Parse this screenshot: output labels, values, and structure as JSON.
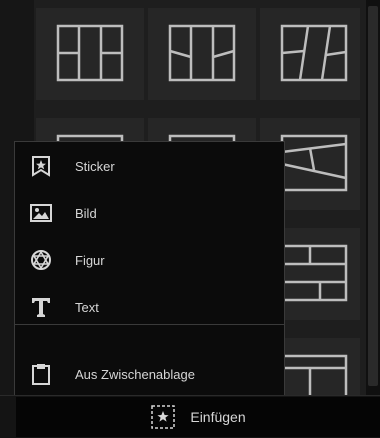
{
  "context_menu": {
    "items": [
      {
        "label": "Sticker",
        "icon": "sticker-icon"
      },
      {
        "label": "Bild",
        "icon": "image-icon"
      },
      {
        "label": "Figur",
        "icon": "shape-icon"
      },
      {
        "label": "Text",
        "icon": "text-icon"
      }
    ],
    "clipboard_item": {
      "label": "Aus Zwischenablage",
      "icon": "clipboard-icon"
    }
  },
  "bottom_bar": {
    "insert_label": "Einfügen",
    "insert_icon": "sticker-icon"
  },
  "layout_tiles": [
    "collage-layout-icon",
    "collage-layout-icon",
    "collage-layout-icon",
    "collage-layout-icon",
    "collage-layout-icon",
    "collage-layout-icon",
    "collage-layout-icon",
    "collage-layout-icon",
    "collage-layout-icon",
    "collage-layout-icon",
    "collage-layout-icon",
    "collage-layout-icon"
  ],
  "colors": {
    "background": "#1e1e1e",
    "menu_background": "#0b0b0b",
    "text": "#d6d6d6",
    "icon_stroke": "#bdbdbd"
  }
}
